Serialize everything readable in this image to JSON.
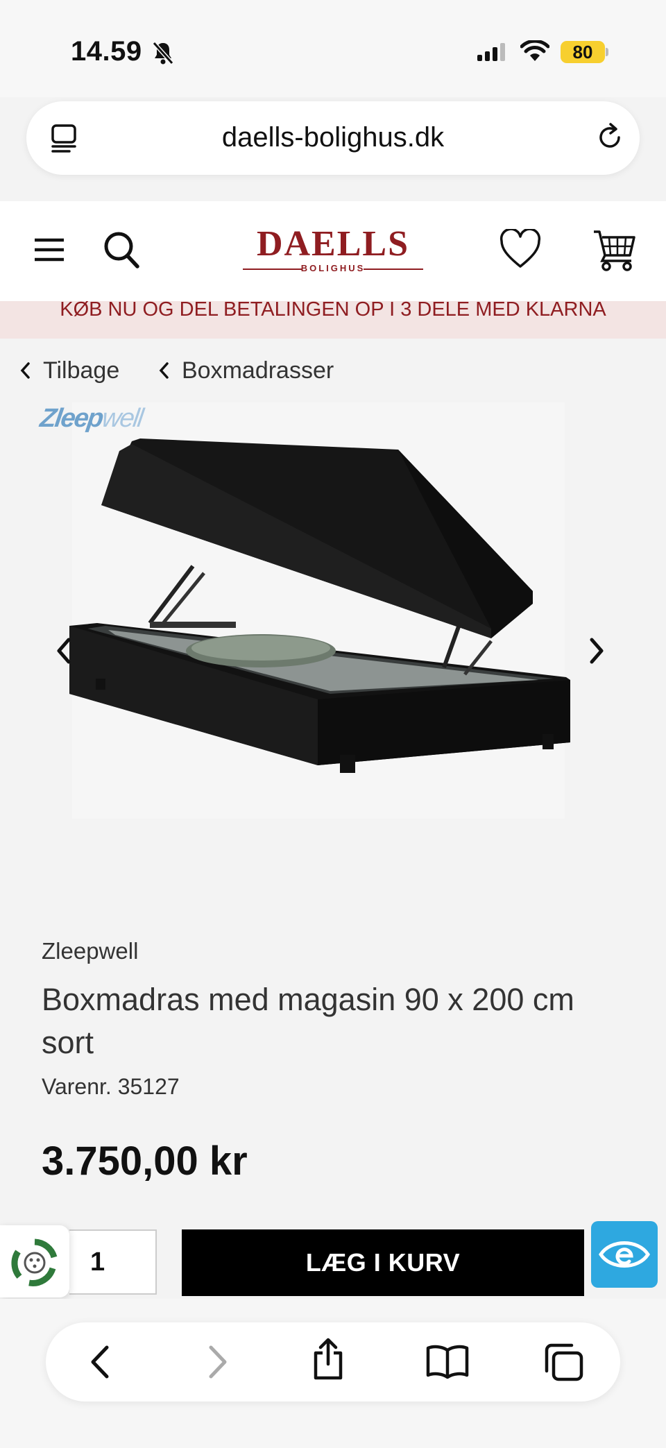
{
  "status_bar": {
    "time": "14.59",
    "battery": "80"
  },
  "browser": {
    "url": "daells-bolighus.dk"
  },
  "header": {
    "logo_text": "DAELLS",
    "logo_subtext": "BOLIGHUS"
  },
  "promo": {
    "text": "KØB NU OG DEL BETALINGEN OP I 3 DELE MED KLARNA"
  },
  "breadcrumb": {
    "back_label": "Tilbage",
    "category_label": "Boxmadrasser"
  },
  "gallery": {
    "brand_badge_bold": "Zleep",
    "brand_badge_light": "well"
  },
  "product": {
    "brand": "Zleepwell",
    "title": "Boxmadras med magasin 90 x 200 cm sort",
    "sku": "Varenr. 35127",
    "price": "3.750,00 kr"
  },
  "buy": {
    "quantity": "1",
    "add_to_cart_label": "LÆG I KURV"
  },
  "colors": {
    "brand_red": "#8f1d21",
    "accessibility_blue": "#2ea8e0",
    "battery_yellow": "#f7cf2f"
  }
}
